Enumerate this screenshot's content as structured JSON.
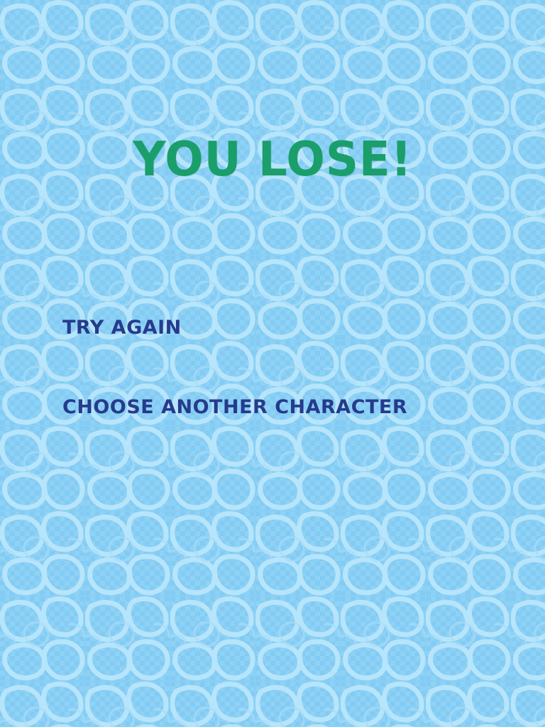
{
  "screen": {
    "title": "YOU LOSE!",
    "menu": {
      "try_again_label": "TRY AGAIN",
      "choose_another_label": "CHOOSE ANOTHER CHARACTER"
    }
  },
  "colors": {
    "background": "#8fd3f6",
    "pattern_light": "#bfe9fc",
    "pattern_dark": "#7cc7f0",
    "title": "#1a9e6a",
    "menu_text": "#263b8c"
  }
}
